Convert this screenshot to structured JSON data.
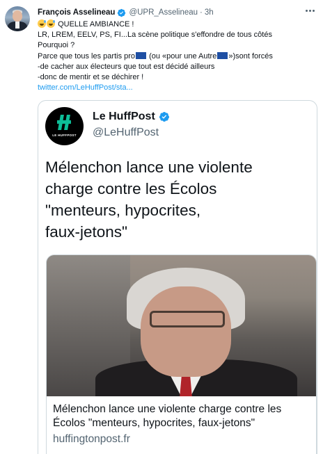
{
  "tweet": {
    "author_name": "François Asselineau",
    "handle": "@UPR_Asselineau",
    "separator": "·",
    "time": "3h",
    "lines": [
      "QUELLE AMBIANCE !",
      "LR, LREM, EELV, PS, FI...La scène politique s'effondre de tous côtés",
      "Pourquoi ?"
    ],
    "line4_a": "Parce que tous les partis pro",
    "line4_b": " (ou «pour une Autre",
    "line4_c": "»)sont forcés",
    "line5": "-de cacher aux électeurs que tout est décidé ailleurs",
    "line6": "-donc de mentir et se déchirer !",
    "link": "twitter.com/LeHuffPost/sta..."
  },
  "quoted": {
    "name": "Le HuffPost",
    "handle": "@LeHuffPost",
    "logo_text": "LE HUFFPOST",
    "headline": [
      "Mélenchon lance une violente",
      "charge contre les Écolos",
      "\"menteurs, hypocrites,",
      "faux-jetons\""
    ],
    "card_title": [
      "Mélenchon lance une violente charge contre les",
      "Écolos \"menteurs, hypocrites, faux-jetons\""
    ],
    "card_domain": "huffingtonpost.fr"
  },
  "colors": {
    "link": "#1d9bf0",
    "verified": "#1d9bf0",
    "huffpost_green": "#0dbe98",
    "flag_blue": "#1f4fa3"
  },
  "icons": [
    "verified-badge-icon",
    "more-options-icon",
    "grinning-sweat-emoji",
    "eu-flag-icon"
  ]
}
